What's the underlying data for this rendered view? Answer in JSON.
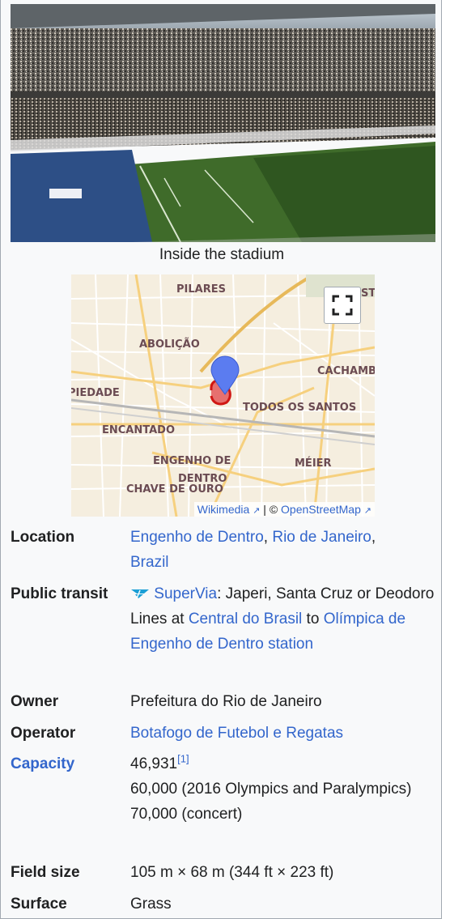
{
  "photo": {
    "icon": "stadium-photo",
    "alt": "Stadium interior with crowd and pitch"
  },
  "caption": "Inside the stadium",
  "map": {
    "districts": [
      "PILARES",
      "ABOLIÇÃO",
      "CACHAMB",
      "PIEDADE",
      "TODOS OS SANTOS",
      "ENCANTADO",
      "ENGENHO DE",
      "DENTRO",
      "CHAVE DE OURO",
      "MÉIER",
      "ST"
    ],
    "attribution": {
      "wikimedia": "Wikimedia",
      "separator": " | © ",
      "osm": "OpenStreetMap"
    },
    "marker_color": "#5b7cf0",
    "stadium_color": "#d40000"
  },
  "rows": {
    "location": {
      "label": "Location",
      "l1": "Engenho de Dentro",
      "sep1": ", ",
      "l2": "Rio de Janeiro",
      "sep2": ",",
      "l3": "Brazil"
    },
    "transit": {
      "label": "Public transit",
      "supervia": "SuperVia",
      "t1": ": Japeri, Santa Cruz or Deodoro Lines at ",
      "central": "Central do Brasil",
      "t2": " to ",
      "station": "Olímpica de Engenho de Dentro station"
    },
    "owner": {
      "label": "Owner",
      "value": "Prefeitura do Rio de Janeiro"
    },
    "operator": {
      "label": "Operator",
      "value": "Botafogo de Futebol e Regatas"
    },
    "capacity": {
      "label": "Capacity",
      "v1": "46,931",
      "ref": "[1]",
      "v2": "60,000 (2016 Olympics and Paralympics)",
      "v3": "70,000 (concert)"
    },
    "field": {
      "label": "Field size",
      "value": "105 m × 68 m (344 ft × 223 ft)"
    },
    "surface": {
      "label": "Surface",
      "value": "Grass"
    }
  },
  "colors": {
    "link": "#3366cc",
    "border": "#a2a9b1",
    "background": "#f8f9fa"
  }
}
